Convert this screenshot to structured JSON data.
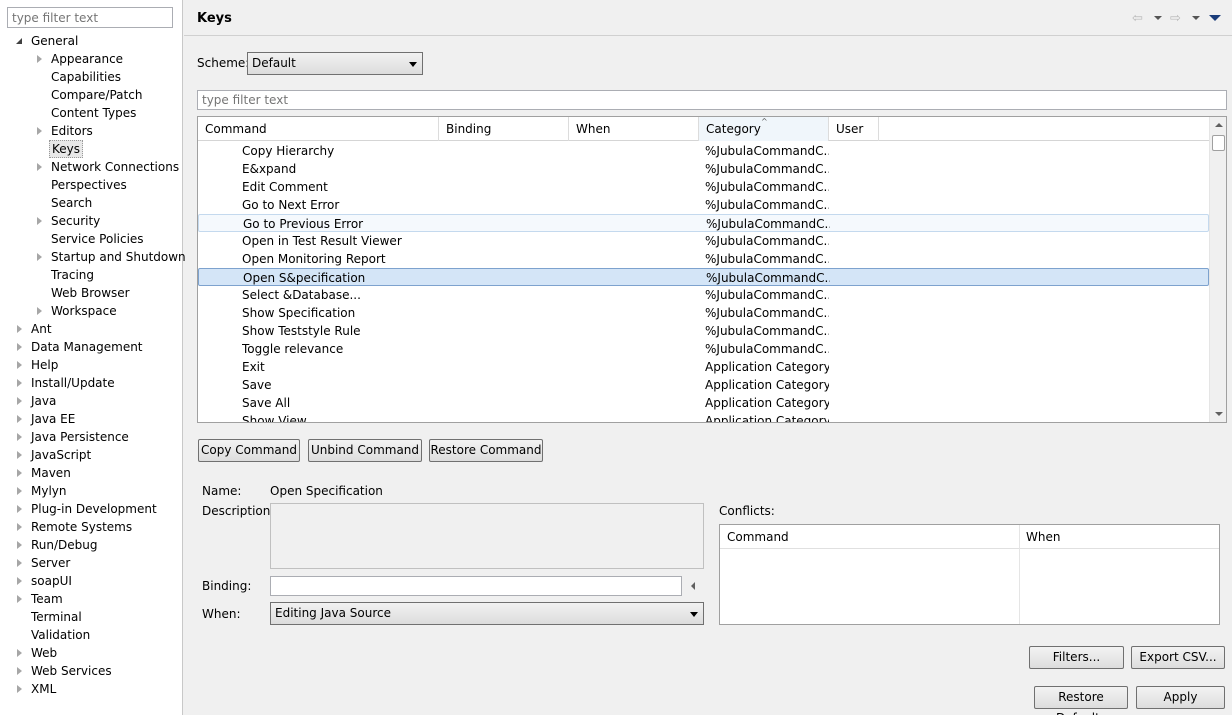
{
  "tree": {
    "filter_placeholder": "type filter text",
    "items": [
      {
        "label": "General",
        "level": 0,
        "state": "open"
      },
      {
        "label": "Appearance",
        "level": 1,
        "state": "closed"
      },
      {
        "label": "Capabilities",
        "level": 1,
        "state": "leaf"
      },
      {
        "label": "Compare/Patch",
        "level": 1,
        "state": "leaf"
      },
      {
        "label": "Content Types",
        "level": 1,
        "state": "leaf"
      },
      {
        "label": "Editors",
        "level": 1,
        "state": "closed"
      },
      {
        "label": "Keys",
        "level": 1,
        "state": "leaf",
        "selected": true
      },
      {
        "label": "Network Connections",
        "level": 1,
        "state": "closed"
      },
      {
        "label": "Perspectives",
        "level": 1,
        "state": "leaf"
      },
      {
        "label": "Search",
        "level": 1,
        "state": "leaf"
      },
      {
        "label": "Security",
        "level": 1,
        "state": "closed"
      },
      {
        "label": "Service Policies",
        "level": 1,
        "state": "leaf"
      },
      {
        "label": "Startup and Shutdown",
        "level": 1,
        "state": "closed"
      },
      {
        "label": "Tracing",
        "level": 1,
        "state": "leaf"
      },
      {
        "label": "Web Browser",
        "level": 1,
        "state": "leaf"
      },
      {
        "label": "Workspace",
        "level": 1,
        "state": "closed"
      },
      {
        "label": "Ant",
        "level": 0,
        "state": "closed"
      },
      {
        "label": "Data Management",
        "level": 0,
        "state": "closed"
      },
      {
        "label": "Help",
        "level": 0,
        "state": "closed"
      },
      {
        "label": "Install/Update",
        "level": 0,
        "state": "closed"
      },
      {
        "label": "Java",
        "level": 0,
        "state": "closed"
      },
      {
        "label": "Java EE",
        "level": 0,
        "state": "closed"
      },
      {
        "label": "Java Persistence",
        "level": 0,
        "state": "closed"
      },
      {
        "label": "JavaScript",
        "level": 0,
        "state": "closed"
      },
      {
        "label": "Maven",
        "level": 0,
        "state": "closed"
      },
      {
        "label": "Mylyn",
        "level": 0,
        "state": "closed"
      },
      {
        "label": "Plug-in Development",
        "level": 0,
        "state": "closed"
      },
      {
        "label": "Remote Systems",
        "level": 0,
        "state": "closed"
      },
      {
        "label": "Run/Debug",
        "level": 0,
        "state": "closed"
      },
      {
        "label": "Server",
        "level": 0,
        "state": "closed"
      },
      {
        "label": "soapUI",
        "level": 0,
        "state": "closed"
      },
      {
        "label": "Team",
        "level": 0,
        "state": "closed"
      },
      {
        "label": "Terminal",
        "level": 0,
        "state": "leaf"
      },
      {
        "label": "Validation",
        "level": 0,
        "state": "leaf"
      },
      {
        "label": "Web",
        "level": 0,
        "state": "closed"
      },
      {
        "label": "Web Services",
        "level": 0,
        "state": "closed"
      },
      {
        "label": "XML",
        "level": 0,
        "state": "closed"
      }
    ]
  },
  "header": {
    "title": "Keys",
    "back_icon": "back-arrow-icon",
    "forward_icon": "forward-arrow-icon",
    "menu_icon": "view-menu-icon"
  },
  "scheme": {
    "label": "Scheme:",
    "value": "Default"
  },
  "filter": {
    "placeholder": "type filter text"
  },
  "table": {
    "columns": [
      "Command",
      "Binding",
      "When",
      "Category",
      "User"
    ],
    "sorted_column": "Category",
    "rows": [
      {
        "command": "Copy Hierarchy",
        "category": "%JubulaCommandC..."
      },
      {
        "command": "E&xpand",
        "category": "%JubulaCommandC..."
      },
      {
        "command": "Edit Comment",
        "category": "%JubulaCommandC..."
      },
      {
        "command": "Go to Next Error",
        "category": "%JubulaCommandC..."
      },
      {
        "command": "Go to Previous Error",
        "category": "%JubulaCommandC...",
        "hover": true
      },
      {
        "command": "Open in Test Result Viewer",
        "category": "%JubulaCommandC..."
      },
      {
        "command": "Open Monitoring Report",
        "category": "%JubulaCommandC..."
      },
      {
        "command": "Open S&pecification",
        "category": "%JubulaCommandC...",
        "selected": true
      },
      {
        "command": "Select &Database...",
        "category": "%JubulaCommandC..."
      },
      {
        "command": "Show Specification",
        "category": "%JubulaCommandC..."
      },
      {
        "command": "Show Teststyle Rule",
        "category": "%JubulaCommandC..."
      },
      {
        "command": "Toggle relevance",
        "category": "%JubulaCommandC..."
      },
      {
        "command": "Exit",
        "category": "Application Category"
      },
      {
        "command": "Save",
        "category": "Application Category"
      },
      {
        "command": "Save All",
        "category": "Application Category"
      },
      {
        "command": "Show View",
        "category": "Application Category"
      }
    ]
  },
  "actions": {
    "copy": "Copy Command",
    "unbind": "Unbind Command",
    "restore": "Restore Command"
  },
  "details": {
    "name_label": "Name:",
    "name_value": "Open Specification",
    "description_label": "Description:",
    "binding_label": "Binding:",
    "binding_value": "",
    "when_label": "When:",
    "when_value": "Editing Java Source"
  },
  "conflicts": {
    "label": "Conflicts:",
    "columns": [
      "Command",
      "When"
    ]
  },
  "buttons": {
    "filters": "Filters...",
    "export": "Export CSV...",
    "restore_defaults": "Restore Defaults",
    "apply": "Apply"
  }
}
